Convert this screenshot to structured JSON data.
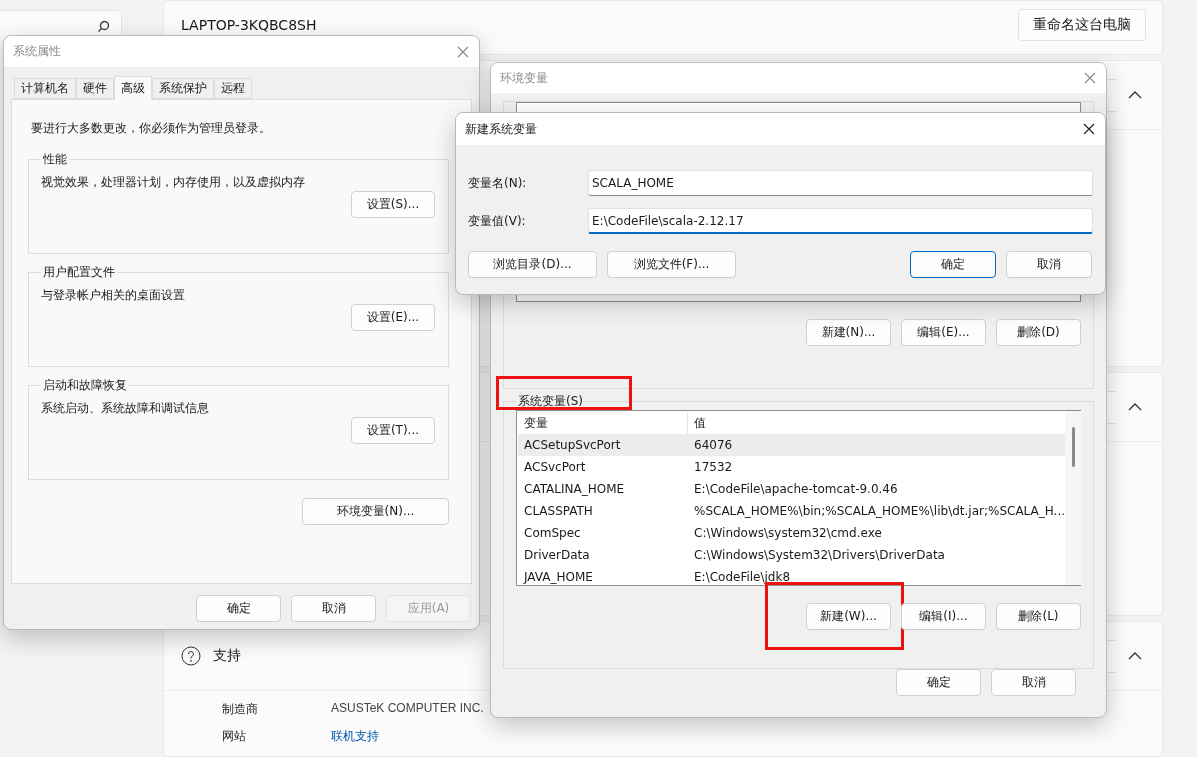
{
  "settings": {
    "device_name": "LAPTOP-3KQBC8SH",
    "rename_button": "重命名这台电脑",
    "support": {
      "title": "支持",
      "expanded": true,
      "rows": [
        {
          "label": "制造商",
          "value": "ASUSTeK COMPUTER INC.",
          "kind": "text"
        },
        {
          "label": "网站",
          "value": "联机支持",
          "kind": "link"
        }
      ]
    }
  },
  "system_properties": {
    "title": "系统属性",
    "tabs": [
      {
        "label": "计算机名",
        "selected": false
      },
      {
        "label": "硬件",
        "selected": false
      },
      {
        "label": "高级",
        "selected": true
      },
      {
        "label": "系统保护",
        "selected": false
      },
      {
        "label": "远程",
        "selected": false
      }
    ],
    "notice": "要进行大多数更改，你必须作为管理员登录。",
    "groups": [
      {
        "title": "性能",
        "description": "视觉效果，处理器计划，内存使用，以及虚拟内存",
        "button": "设置(S)..."
      },
      {
        "title": "用户配置文件",
        "description": "与登录帐户相关的桌面设置",
        "button": "设置(E)..."
      },
      {
        "title": "启动和故障恢复",
        "description": "系统启动、系统故障和调试信息",
        "button": "设置(T)..."
      }
    ],
    "env_button": "环境变量(N)...",
    "buttons": [
      {
        "label": "确定",
        "disabled": false
      },
      {
        "label": "取消",
        "disabled": false
      },
      {
        "label": "应用(A)",
        "disabled": true
      }
    ]
  },
  "environment_variables": {
    "title": "环境变量",
    "user_buttons": [
      {
        "label": "新建(N)...",
        "highlighted": false
      },
      {
        "label": "编辑(E)...",
        "highlighted": false
      },
      {
        "label": "删除(D)",
        "highlighted": false
      }
    ],
    "system_group": {
      "label": "系统变量(S)",
      "highlighted": true
    },
    "columns": [
      "变量",
      "值"
    ],
    "rows": [
      {
        "name": "ACSetupSvcPort",
        "value": "64076",
        "selected": true
      },
      {
        "name": "ACSvcPort",
        "value": "17532",
        "selected": false
      },
      {
        "name": "CATALINA_HOME",
        "value": "E:\\CodeFile\\apache-tomcat-9.0.46",
        "selected": false
      },
      {
        "name": "CLASSPATH",
        "value": "%SCALA_HOME%\\bin;%SCALA_HOME%\\lib\\dt.jar;%SCALA_H...",
        "selected": false
      },
      {
        "name": "ComSpec",
        "value": "C:\\Windows\\system32\\cmd.exe",
        "selected": false
      },
      {
        "name": "DriverData",
        "value": "C:\\Windows\\System32\\Drivers\\DriverData",
        "selected": false
      },
      {
        "name": "JAVA_HOME",
        "value": "E:\\CodeFile\\jdk8",
        "selected": false
      }
    ],
    "system_buttons": [
      {
        "label": "新建(W)...",
        "highlighted": true
      },
      {
        "label": "编辑(I)...",
        "highlighted": false
      },
      {
        "label": "删除(L)",
        "highlighted": false
      }
    ],
    "buttons": [
      "确定",
      "取消"
    ]
  },
  "new_variable_dialog": {
    "title": "新建系统变量",
    "fields": [
      {
        "label": "变量名(N):",
        "value": "SCALA_HOME",
        "focused": false
      },
      {
        "label": "变量值(V):",
        "value": "E:\\CodeFile\\scala-2.12.17",
        "focused": true
      }
    ],
    "left_buttons": [
      "浏览目录(D)...",
      "浏览文件(F)..."
    ],
    "buttons": [
      {
        "label": "确定",
        "default": true
      },
      {
        "label": "取消",
        "default": false
      }
    ]
  }
}
